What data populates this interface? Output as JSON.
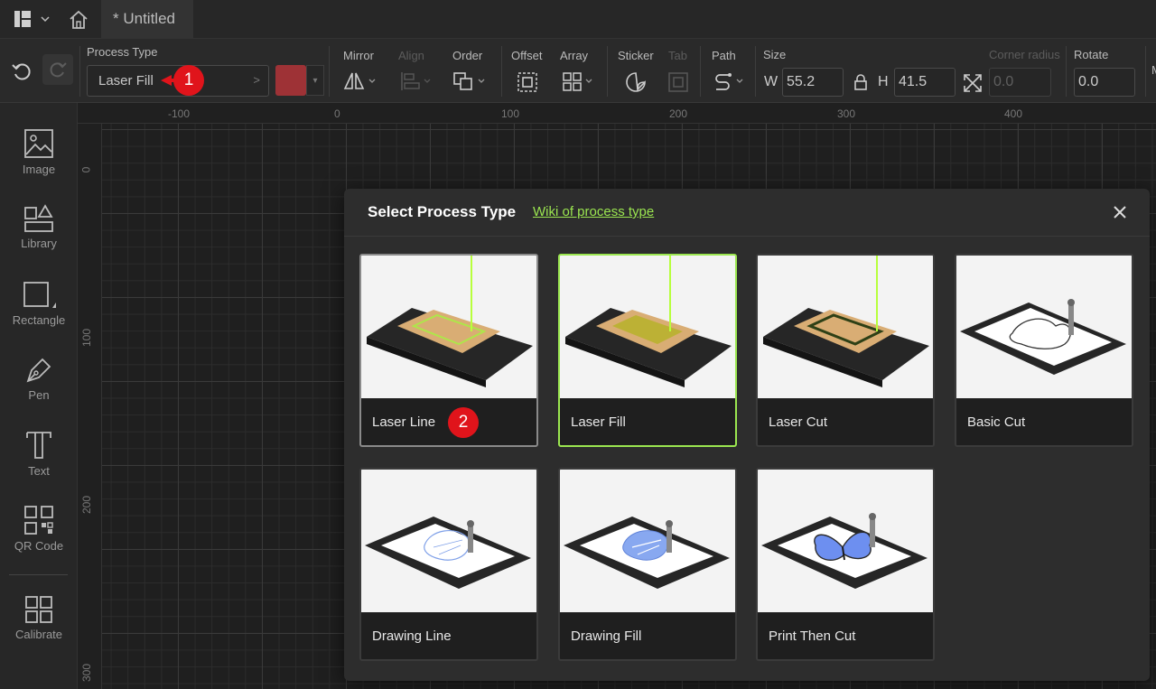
{
  "titlebar": {
    "doc_tab": "* Untitled"
  },
  "toolbar": {
    "process_type_label": "Process Type",
    "process_type_value": "Laser Fill",
    "color": "#9e3236",
    "mirror": "Mirror",
    "align": "Align",
    "order": "Order",
    "offset": "Offset",
    "array": "Array",
    "sticker": "Sticker",
    "tab": "Tab",
    "path": "Path",
    "size": "Size",
    "width_label": "W",
    "width_value": "55.2",
    "height_label": "H",
    "height_value": "41.5",
    "corner_radius": "Corner radius",
    "corner_radius_value": "0.0",
    "rotate": "Rotate",
    "rotate_value": "0.0",
    "overflow_label": "M"
  },
  "sidebar": {
    "items": [
      {
        "label": "Image"
      },
      {
        "label": "Library"
      },
      {
        "label": "Rectangle"
      },
      {
        "label": "Pen"
      },
      {
        "label": "Text"
      },
      {
        "label": "QR Code"
      },
      {
        "label": "Calibrate"
      }
    ]
  },
  "rulers": {
    "top": [
      "-100",
      "0",
      "100",
      "200",
      "300",
      "400"
    ],
    "left": [
      "0",
      "100",
      "200",
      "300"
    ]
  },
  "dialog": {
    "title": "Select Process Type",
    "wiki_link": "Wiki of process type",
    "options": [
      {
        "label": "Laser Line",
        "state": "hovered"
      },
      {
        "label": "Laser Fill",
        "state": "selected"
      },
      {
        "label": "Laser Cut",
        "state": "normal"
      },
      {
        "label": "Basic Cut",
        "state": "normal"
      },
      {
        "label": "Drawing Line",
        "state": "normal"
      },
      {
        "label": "Drawing Fill",
        "state": "normal"
      },
      {
        "label": "Print Then Cut",
        "state": "normal"
      }
    ]
  },
  "annotations": {
    "badge1": "1",
    "badge2": "2",
    "accent": "#9be650",
    "badge_color": "#e0141b"
  }
}
